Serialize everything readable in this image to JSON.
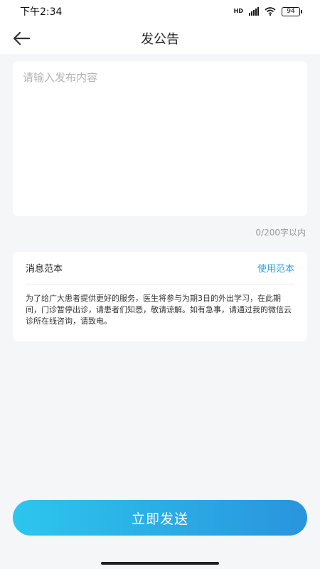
{
  "status_bar": {
    "time": "下午2:34",
    "hd_label": "HD",
    "battery": "94"
  },
  "nav": {
    "title": "发公告",
    "back_icon": "arrow-left-icon"
  },
  "content_input": {
    "placeholder": "请输入发布内容",
    "value": ""
  },
  "counter": "0/200字以内",
  "template": {
    "title": "消息范本",
    "use_label": "使用范本",
    "body": "为了给广大患者提供更好的服务，医生将参与为期3日的外出学习，在此期间，门诊暂停出诊，请患者们知悉，敬请谅解。如有急事，请通过我的微信云诊所在线咨询，请致电。"
  },
  "send_button": {
    "label": "立即发送"
  },
  "colors": {
    "accent": "#2aa3e6",
    "gradient_start": "#2cc6ee",
    "gradient_end": "#2a94dd",
    "background": "#f5f6f8"
  }
}
